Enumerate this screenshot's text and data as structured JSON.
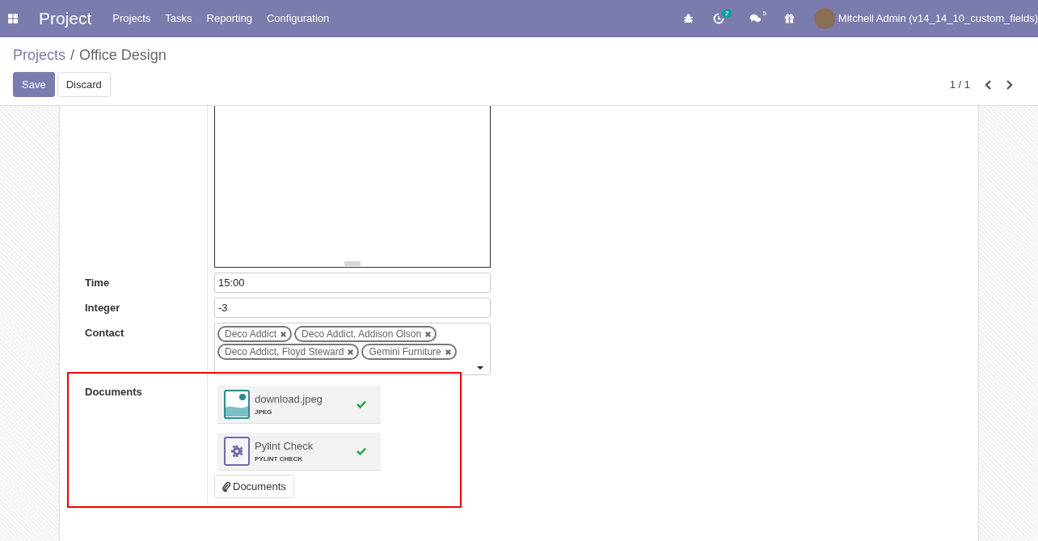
{
  "navbar": {
    "app_title": "Project",
    "menu": [
      "Projects",
      "Tasks",
      "Reporting",
      "Configuration"
    ],
    "activity_count": "2",
    "message_count": "5",
    "user": "Mitchell Admin (v14_14_10_custom_fields)"
  },
  "breadcrumb": {
    "parent": "Projects",
    "separator": "/",
    "current": "Office Design"
  },
  "buttons": {
    "save": "Save",
    "discard": "Discard"
  },
  "pager": {
    "value": "1 / 1"
  },
  "form": {
    "time": {
      "label": "Time",
      "value": "15:00"
    },
    "integer": {
      "label": "Integer",
      "value": "-3"
    },
    "contact": {
      "label": "Contact",
      "tags": [
        "Deco Addict",
        "Deco Addict, Addison Olson",
        "Deco Addict, Floyd Steward",
        "Gemini Furniture"
      ]
    },
    "documents": {
      "label": "Documents",
      "files": [
        {
          "kind": "image",
          "name": "download.jpeg",
          "type": "JPEG"
        },
        {
          "kind": "gear",
          "name": "Pylint Check",
          "type": "PYLINT CHECK"
        }
      ],
      "button": "Documents"
    }
  }
}
